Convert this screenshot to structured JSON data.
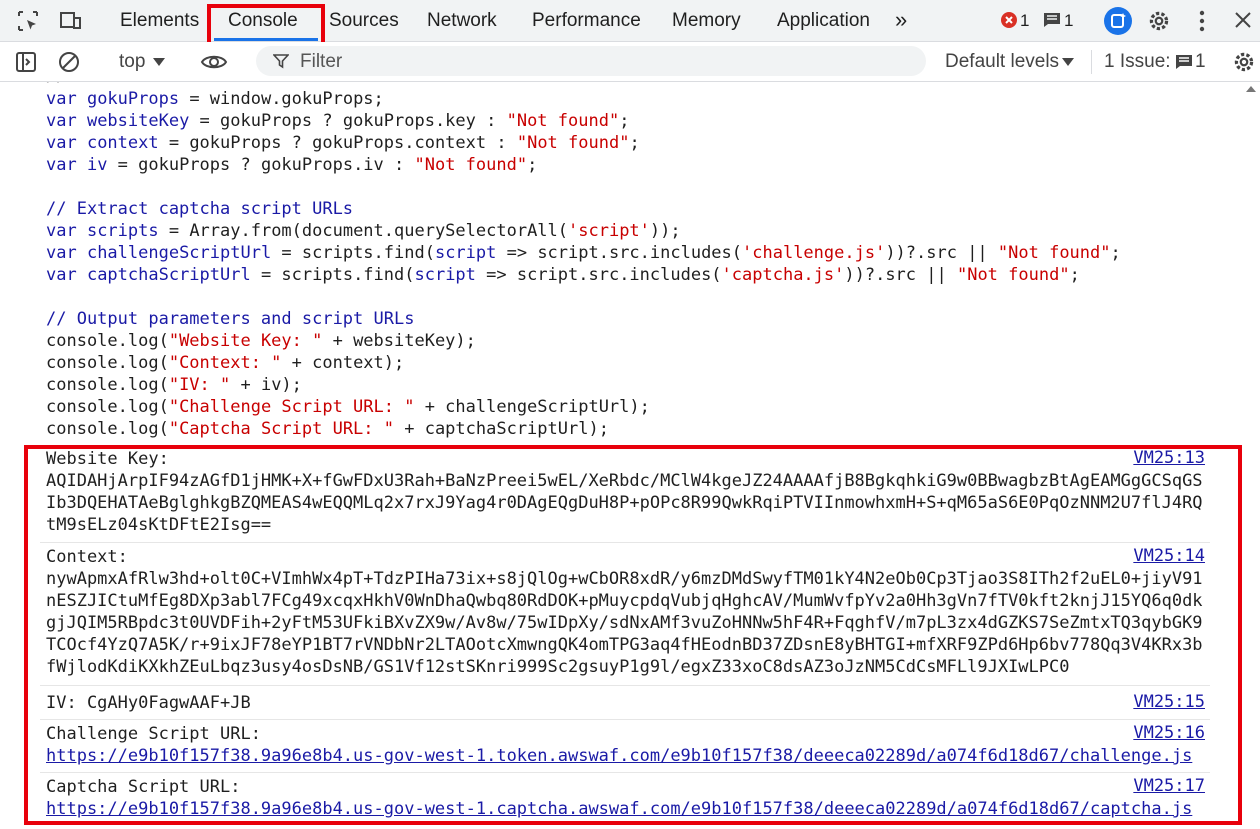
{
  "tabs": [
    "Elements",
    "Console",
    "Sources",
    "Network",
    "Performance",
    "Memory",
    "Application"
  ],
  "more_tabs": "»",
  "errors_count": "1",
  "messages_count": "1",
  "toolbar": {
    "context": "top",
    "filter_placeholder": "Filter",
    "levels": "Default levels",
    "issues_label": "1 Issue:",
    "issues_count": "1"
  },
  "code_lines": [
    {
      "parts": [
        {
          "t": "var ",
          "c": "kw"
        },
        {
          "t": "gokuProps",
          "c": "vn"
        },
        {
          "t": " = window.gokuProps;",
          "c": ""
        }
      ]
    },
    {
      "parts": [
        {
          "t": "var ",
          "c": "kw"
        },
        {
          "t": "websiteKey",
          "c": "vn"
        },
        {
          "t": " = gokuProps ? gokuProps.key : ",
          "c": ""
        },
        {
          "t": "\"Not found\"",
          "c": "str"
        },
        {
          "t": ";",
          "c": ""
        }
      ]
    },
    {
      "parts": [
        {
          "t": "var ",
          "c": "kw"
        },
        {
          "t": "context",
          "c": "vn"
        },
        {
          "t": " = gokuProps ? gokuProps.context : ",
          "c": ""
        },
        {
          "t": "\"Not found\"",
          "c": "str"
        },
        {
          "t": ";",
          "c": ""
        }
      ]
    },
    {
      "parts": [
        {
          "t": "var ",
          "c": "kw"
        },
        {
          "t": "iv",
          "c": "vn"
        },
        {
          "t": " = gokuProps ? gokuProps.iv : ",
          "c": ""
        },
        {
          "t": "\"Not found\"",
          "c": "str"
        },
        {
          "t": ";",
          "c": ""
        }
      ]
    },
    {
      "parts": []
    },
    {
      "parts": [
        {
          "t": "// Extract captcha script URLs",
          "c": "cm"
        }
      ]
    },
    {
      "parts": [
        {
          "t": "var ",
          "c": "kw"
        },
        {
          "t": "scripts",
          "c": "vn"
        },
        {
          "t": " = Array.from(document.querySelectorAll(",
          "c": ""
        },
        {
          "t": "'script'",
          "c": "str"
        },
        {
          "t": "));",
          "c": ""
        }
      ]
    },
    {
      "parts": [
        {
          "t": "var ",
          "c": "kw"
        },
        {
          "t": "challengeScriptUrl",
          "c": "vn"
        },
        {
          "t": " = scripts.find(",
          "c": ""
        },
        {
          "t": "script",
          "c": "vn"
        },
        {
          "t": " => script.src.includes(",
          "c": ""
        },
        {
          "t": "'challenge.js'",
          "c": "str"
        },
        {
          "t": "))?.src || ",
          "c": ""
        },
        {
          "t": "\"Not found\"",
          "c": "str"
        },
        {
          "t": ";",
          "c": ""
        }
      ]
    },
    {
      "parts": [
        {
          "t": "var ",
          "c": "kw"
        },
        {
          "t": "captchaScriptUrl",
          "c": "vn"
        },
        {
          "t": " = scripts.find(",
          "c": ""
        },
        {
          "t": "script",
          "c": "vn"
        },
        {
          "t": " => script.src.includes(",
          "c": ""
        },
        {
          "t": "'captcha.js'",
          "c": "str"
        },
        {
          "t": "))?.src || ",
          "c": ""
        },
        {
          "t": "\"Not found\"",
          "c": "str"
        },
        {
          "t": ";",
          "c": ""
        }
      ]
    },
    {
      "parts": []
    },
    {
      "parts": [
        {
          "t": "// Output parameters and script URLs",
          "c": "cm"
        }
      ]
    },
    {
      "parts": [
        {
          "t": "console.log(",
          "c": ""
        },
        {
          "t": "\"Website Key: \"",
          "c": "str"
        },
        {
          "t": " + websiteKey);",
          "c": ""
        }
      ]
    },
    {
      "parts": [
        {
          "t": "console.log(",
          "c": ""
        },
        {
          "t": "\"Context: \"",
          "c": "str"
        },
        {
          "t": " + context);",
          "c": ""
        }
      ]
    },
    {
      "parts": [
        {
          "t": "console.log(",
          "c": ""
        },
        {
          "t": "\"IV: \"",
          "c": "str"
        },
        {
          "t": " + iv);",
          "c": ""
        }
      ]
    },
    {
      "parts": [
        {
          "t": "console.log(",
          "c": ""
        },
        {
          "t": "\"Challenge Script URL: \"",
          "c": "str"
        },
        {
          "t": " + challengeScriptUrl);",
          "c": ""
        }
      ]
    },
    {
      "parts": [
        {
          "t": "console.log(",
          "c": ""
        },
        {
          "t": "\"Captcha Script URL: \"",
          "c": "str"
        },
        {
          "t": " + captchaScriptUrl);",
          "c": ""
        }
      ]
    }
  ],
  "output": {
    "website_key_label": "Website Key:",
    "website_key_value": "AQIDAHjArpIF94zAGfD1jHMK+X+fGwFDxU3Rah+BaNzPreei5wEL/XeRbdc/MClW4kgeJZ24AAAAfjB8BgkqhkiG9w0BBwagbzBtAgEAMGgGCSqGSIb3DQEHATAeBglghkgBZQMEAS4wEQQMLq2x7rxJ9Yag4r0DAgEQgDuH8P+pOPc8R99QwkRqiPTVIInmowhxmH+S+qM65aS6E0PqOzNNM2U7flJ4RQtM9sELz04sKtDFtE2Isg==",
    "website_key_src": "VM25:13",
    "context_label": "Context:",
    "context_value": "nywApmxAfRlw3hd+olt0C+VImhWx4pT+TdzPIHa73ix+s8jQlOg+wCbOR8xdR/y6mzDMdSwyfTM01kY4N2eOb0Cp3Tjao3S8ITh2f2uEL0+jiyV91nESZJICtuMfEg8DXp3abl7FCg49xcqxHkhV0WnDhaQwbq80RdDOK+pMuycpdqVubjqHghcAV/MumWvfpYv2a0Hh3gVn7fTV0kft2knjJ15YQ6q0dkgjJQIM5RBpdc3t0UVDFih+2yFtM53UFkiBXvZX9w/Av8w/75wIDpXy/sdNxAMf3vuZoHNNw5hF4R+FqghfV/m7pL3zx4dGZKS7SeZmtxTQ3qybGK9TCOcf4YzQ7A5K/r+9ixJF78eYP1BT7rVNDbNr2LTAOotcXmwngQK4omTPG3aq4fHEodnBD37ZDsnE8yBHTGI+mfXRF9ZPd6Hp6bv778Qq3V4KRx3bfWjlodKdiKXkhZEuLbqz3usy4osDsNB/GS1Vf12stSKnri999Sc2gsuyP1g9l/egxZ33xoC8dsAZ3oJzNM5CdCsMFLl9JXIwLPC0",
    "context_src": "VM25:14",
    "iv_text": "IV: CgAHy0FagwAAF+JB",
    "iv_src": "VM25:15",
    "challenge_label": "Challenge Script URL:",
    "challenge_url": "https://e9b10f157f38.9a96e8b4.us-gov-west-1.token.awswaf.com/e9b10f157f38/deeeca02289d/a074f6d18d67/challenge.js",
    "challenge_src": "VM25:16",
    "captcha_label": "Captcha Script URL:",
    "captcha_url": "https://e9b10f157f38.9a96e8b4.us-gov-west-1.captcha.awswaf.com/e9b10f157f38/deeeca02289d/a074f6d18d67/captcha.js",
    "captcha_src": "VM25:17"
  }
}
